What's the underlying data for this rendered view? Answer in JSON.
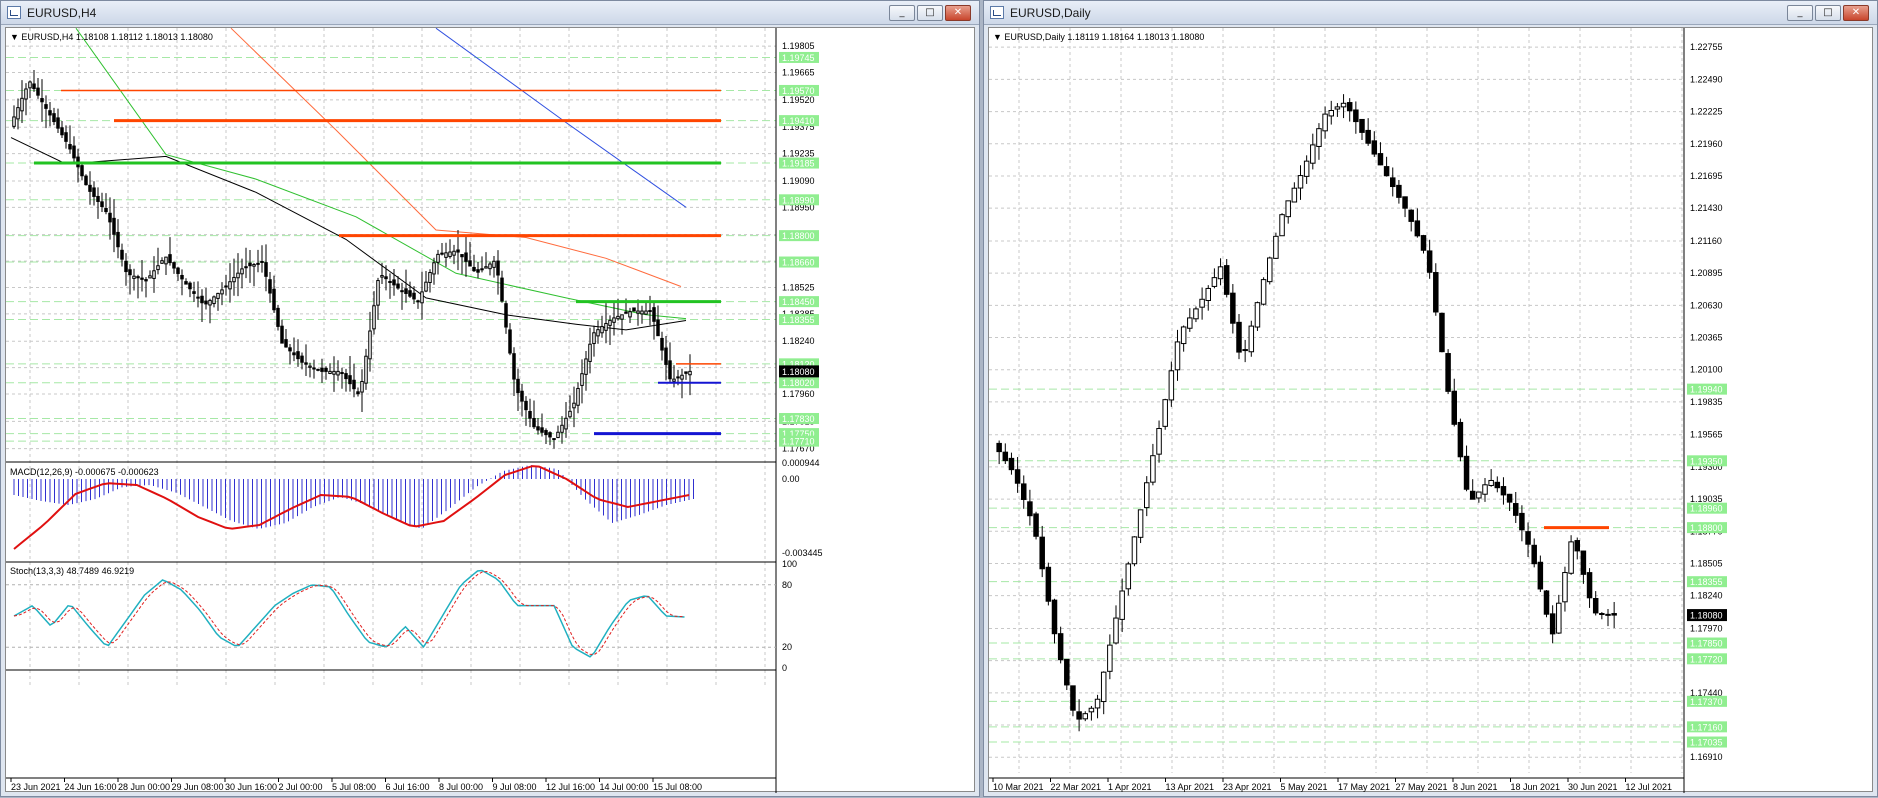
{
  "h4": {
    "title": "EURUSD,H4",
    "buttons": {
      "minimize": "_",
      "maximize": "□",
      "close": "✕"
    },
    "header": "EURUSD,H4  1.18108 1.18112 1.18013 1.18080",
    "price_labels": [
      "1.19805",
      "1.19665",
      "1.19520",
      "1.19375",
      "1.19235",
      "1.19090",
      "1.18950",
      "1.18805",
      "1.18665",
      "1.18525",
      "1.18385",
      "1.18240",
      "1.18100",
      "1.17960",
      "1.17815",
      "1.17670"
    ],
    "level_tags": [
      "1.19745",
      "1.19570",
      "1.19410",
      "1.19185",
      "1.18990",
      "1.18800",
      "1.18660",
      "1.18450",
      "1.18355",
      "1.18120",
      "1.18020",
      "1.17830",
      "1.17750",
      "1.17710"
    ],
    "current_price": "1.18080",
    "macd_header": "MACD(12,26,9) -0.000675 -0.000623",
    "macd_scale": [
      "0.000944",
      "0.00",
      "-0.003445"
    ],
    "stoch_header": "Stoch(13,3,3) 48.7489 46.9219",
    "stoch_scale": [
      "100",
      "80",
      "20",
      "0"
    ],
    "dates": [
      "23 Jun 2021",
      "24 Jun 16:00",
      "28 Jun 00:00",
      "29 Jun 08:00",
      "30 Jun 16:00",
      "2 Jul 00:00",
      "5 Jul 08:00",
      "6 Jul 16:00",
      "8 Jul 00:00",
      "9 Jul 08:00",
      "12 Jul 16:00",
      "14 Jul 00:00",
      "15 Jul 08:00"
    ]
  },
  "daily": {
    "title": "EURUSD,Daily",
    "buttons": {
      "minimize": "_",
      "maximize": "□",
      "close": "✕"
    },
    "header": "EURUSD,Daily  1.18119 1.18164 1.18013 1.18080",
    "price_labels": [
      "1.22755",
      "1.22490",
      "1.22225",
      "1.21960",
      "1.21695",
      "1.21430",
      "1.21160",
      "1.20895",
      "1.20630",
      "1.20365",
      "1.20100",
      "1.19835",
      "1.19565",
      "1.19300",
      "1.19035",
      "1.18770",
      "1.18505",
      "1.18240",
      "1.17970",
      "1.17705",
      "1.17440",
      "1.17175",
      "1.16910"
    ],
    "level_tags": [
      "1.19940",
      "1.19350",
      "1.18960",
      "1.18800",
      "1.18355",
      "1.17850",
      "1.17720",
      "1.17370",
      "1.17160",
      "1.17035"
    ],
    "current_price": "1.18080",
    "dates": [
      "10 Mar 2021",
      "22 Mar 2021",
      "1 Apr 2021",
      "13 Apr 2021",
      "23 Apr 2021",
      "5 May 2021",
      "17 May 2021",
      "27 May 2021",
      "8 Jun 2021",
      "18 Jun 2021",
      "30 Jun 2021",
      "12 Jul 2021"
    ]
  },
  "colors": {
    "bull": "#ffffff",
    "bear": "#000000",
    "resistance": "#ff4500",
    "support_green": "#22c322",
    "support_blue": "#1414d2",
    "ma_red": "#ff6b3d",
    "ma_blue": "#3050e0",
    "ma_green": "#30c030",
    "macd_hist": "#3030d0",
    "macd_signal": "#e01010",
    "stoch_main": "#20b0c0",
    "stoch_signal": "#e02020",
    "tag_bg": "#90ee90"
  }
}
